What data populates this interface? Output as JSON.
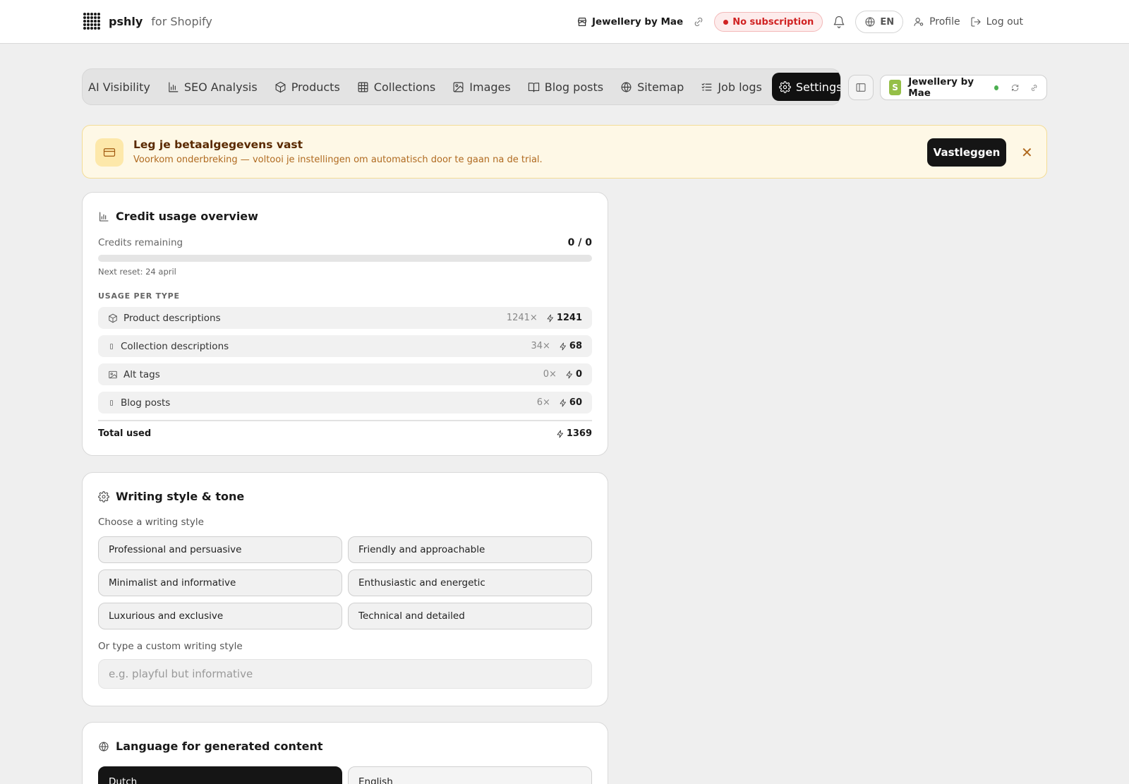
{
  "topbar": {
    "brand_name": "pshly",
    "brand_suffix": "for Shopify",
    "store_name": "Jewellery by Mae",
    "subscription_badge": "No subscription",
    "language_label": "EN",
    "profile_label": "Profile",
    "logout_label": "Log out"
  },
  "nav": {
    "tabs": [
      {
        "label": "AI Visibility",
        "icon": "sparkle-icon"
      },
      {
        "label": "SEO Analysis",
        "icon": "bar-chart-icon"
      },
      {
        "label": "Products",
        "icon": "box-icon"
      },
      {
        "label": "Collections",
        "icon": "grid-icon"
      },
      {
        "label": "Images",
        "icon": "image-icon"
      },
      {
        "label": "Blog posts",
        "icon": "book-icon"
      },
      {
        "label": "Sitemap",
        "icon": "globe-icon"
      },
      {
        "label": "Job logs",
        "icon": "list-check-icon"
      },
      {
        "label": "Settings",
        "icon": "gear-icon",
        "active": true
      }
    ],
    "store_card_name": "Jewellery by Mae"
  },
  "banner": {
    "title": "Leg je betaalgegevens vast",
    "subtitle": "Voorkom onderbreking — voltooi je instellingen om automatisch door te gaan na de trial.",
    "button_label": "Vastleggen",
    "close_label": "✕"
  },
  "credits": {
    "title": "Credit usage overview",
    "remaining_label": "Credits remaining",
    "remaining_value": "0 / 0",
    "progress_fraction": 0,
    "reset_text": "Next reset: 24 april",
    "usage_heading": "USAGE PER TYPE",
    "usage": [
      {
        "name": "Product descriptions",
        "count": "1241×",
        "credits": "1241",
        "icon": "box-icon"
      },
      {
        "name": "Collection descriptions",
        "count": "34×",
        "credits": "68",
        "icon": "tag-icon"
      },
      {
        "name": "Alt tags",
        "count": "0×",
        "credits": "0",
        "icon": "image-icon"
      },
      {
        "name": "Blog posts",
        "count": "6×",
        "credits": "60",
        "icon": "doc-icon"
      }
    ],
    "total_label": "Total used",
    "total_value": "1369"
  },
  "writing_style": {
    "title": "Writing style & tone",
    "choose_label": "Choose a writing style",
    "options": [
      "Professional and persuasive",
      "Friendly and approachable",
      "Minimalist and informative",
      "Enthusiastic and energetic",
      "Luxurious and exclusive",
      "Technical and detailed"
    ],
    "custom_label": "Or type a custom writing style",
    "custom_placeholder": "e.g. playful but informative",
    "custom_value": ""
  },
  "language": {
    "title": "Language for generated content",
    "options": [
      {
        "label": "Dutch",
        "active": true
      },
      {
        "label": "English",
        "active": false
      }
    ]
  }
}
